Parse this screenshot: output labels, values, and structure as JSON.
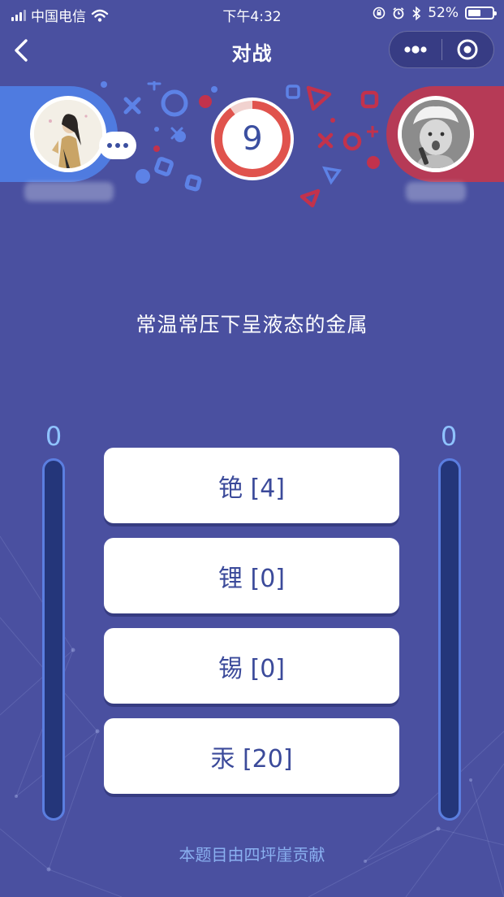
{
  "status_bar": {
    "carrier": "中国电信",
    "time": "下午4:32",
    "battery_percent": "52%",
    "battery_level": 0.52,
    "icons": [
      "signal-icon",
      "wifi-icon",
      "lock-rotation-icon",
      "alarm-icon",
      "bluetooth-icon",
      "battery-icon"
    ]
  },
  "nav": {
    "title": "对战",
    "back_icon": "chevron-left-icon",
    "menu_icon": "more-icon",
    "close_icon": "target-close-icon"
  },
  "battle": {
    "timer": "9",
    "timer_progress": 0.9,
    "left_player": {
      "score": "0",
      "score_fraction": 0,
      "color": "#4f7be0"
    },
    "right_player": {
      "score": "0",
      "score_fraction": 0,
      "color": "#b63a56"
    }
  },
  "question": {
    "text": "常温常压下呈液态的金属",
    "options": [
      {
        "label": "铯 [4]"
      },
      {
        "label": "锂 [0]"
      },
      {
        "label": "锡 [0]"
      },
      {
        "label": "汞 [20]"
      }
    ]
  },
  "footer": {
    "credit": "本题目由四坪崖贡献"
  },
  "colors": {
    "background": "#4a50a0",
    "accent_blue": "#4f7be0",
    "accent_red": "#b63a56",
    "score_text": "#8fc3ff",
    "option_text": "#3b4a9a"
  }
}
